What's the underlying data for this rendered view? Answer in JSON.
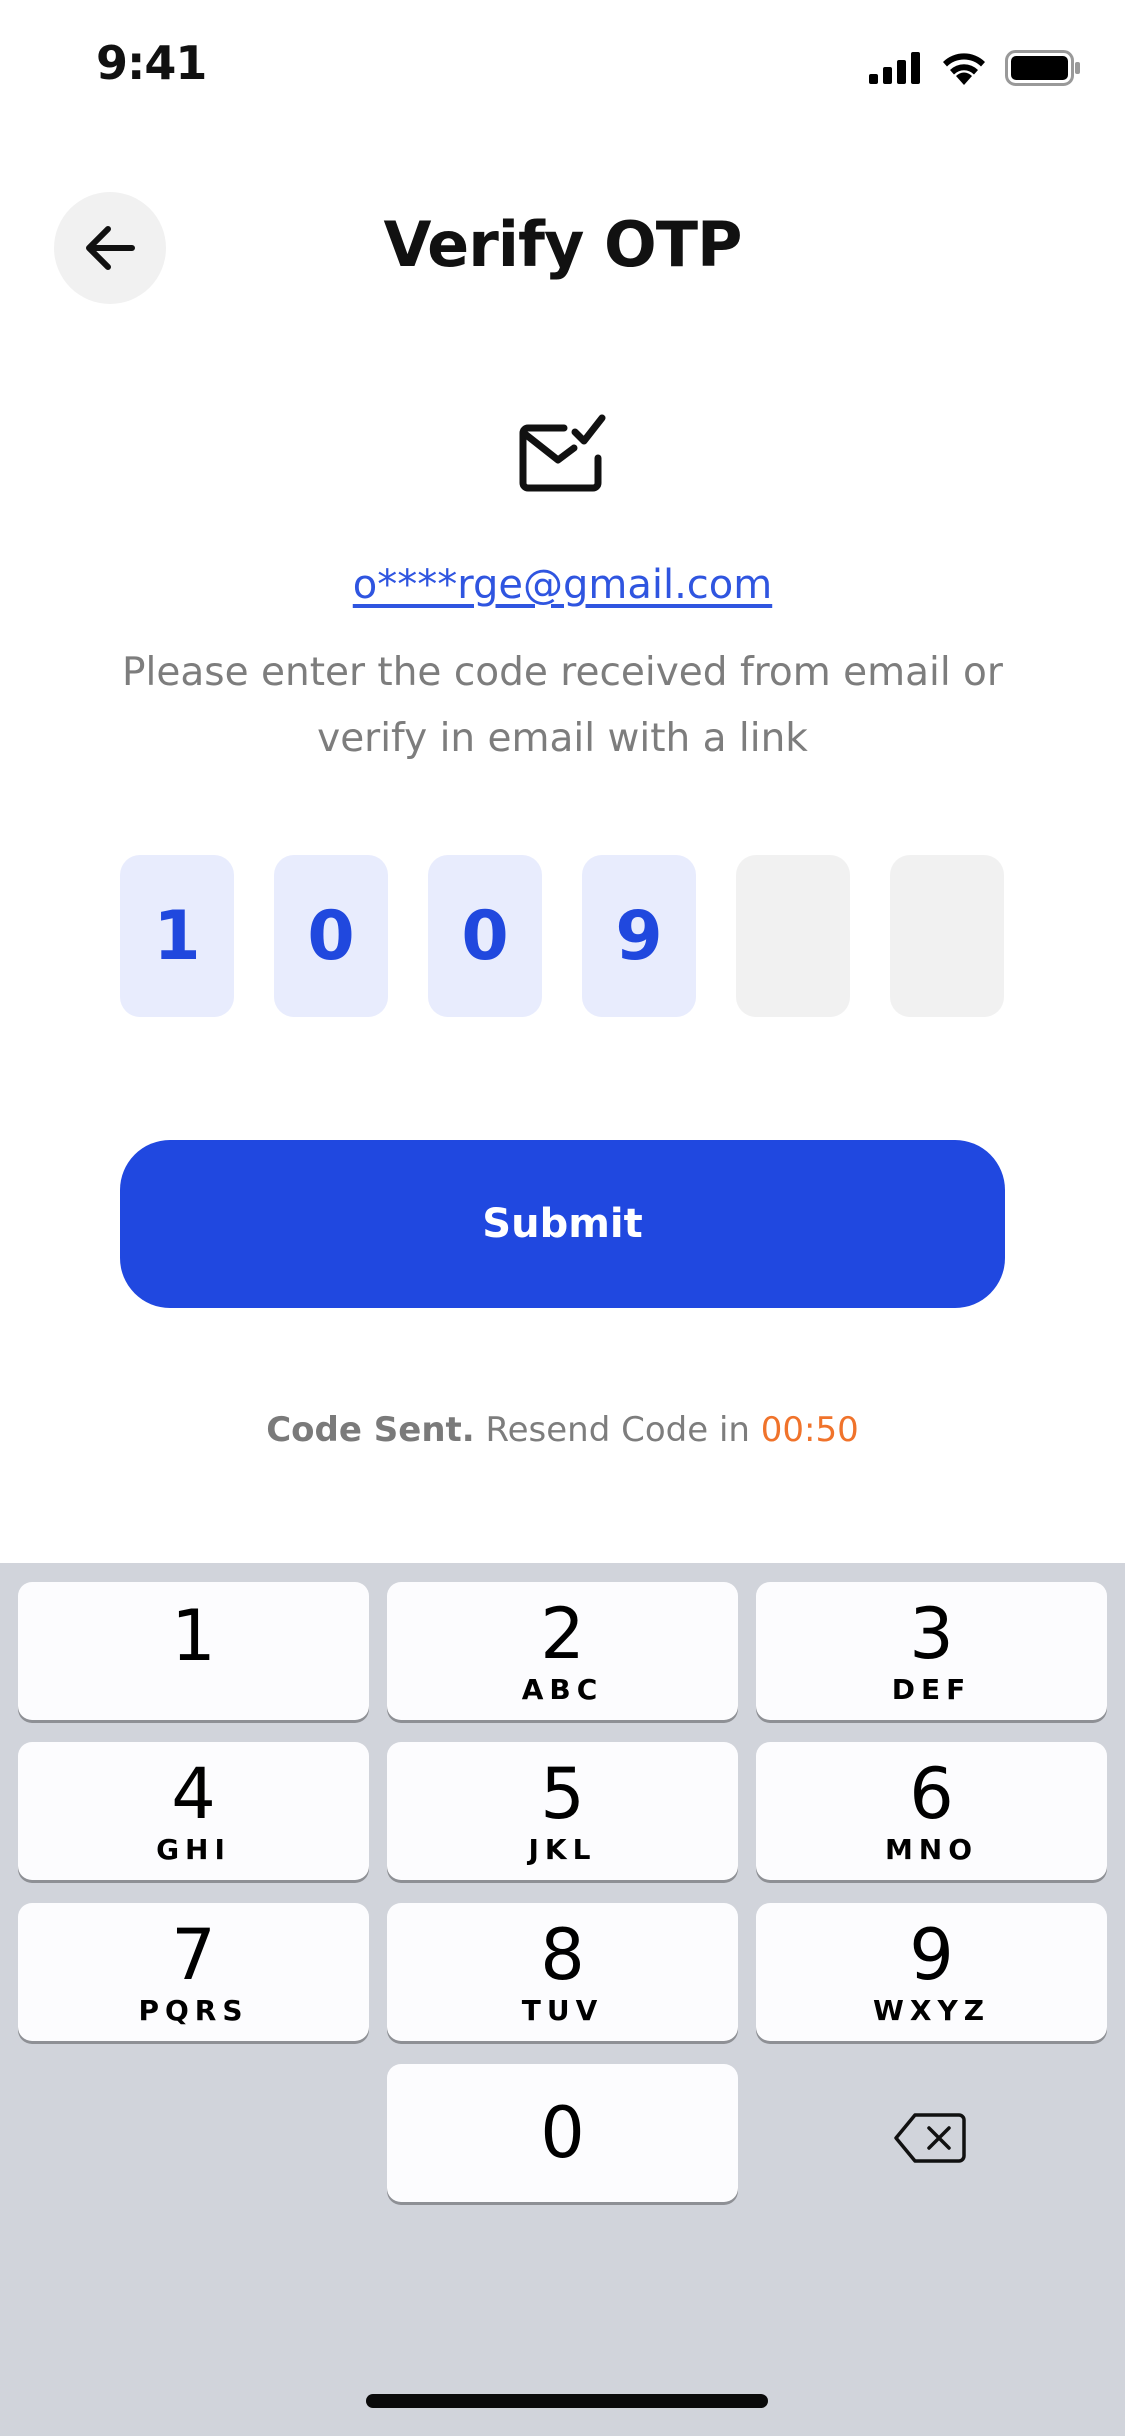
{
  "status_bar": {
    "time": "9:41"
  },
  "header": {
    "title": "Verify OTP"
  },
  "email": "o****rge@gmail.com",
  "instruction": "Please enter the code received from email or verify in email with a link",
  "otp": {
    "digits": [
      "1",
      "0",
      "0",
      "9",
      "",
      ""
    ]
  },
  "submit_label": "Submit",
  "resend": {
    "sent_label": "Code Sent.",
    "resend_label": "Resend Code in",
    "timer": "00:50"
  },
  "colors": {
    "accent": "#2048e0",
    "timer": "#f0732b",
    "link": "#2f55e0"
  },
  "keyboard": {
    "keys": [
      {
        "num": "1",
        "letters": ""
      },
      {
        "num": "2",
        "letters": "ABC"
      },
      {
        "num": "3",
        "letters": "DEF"
      },
      {
        "num": "4",
        "letters": "GHI"
      },
      {
        "num": "5",
        "letters": "JKL"
      },
      {
        "num": "6",
        "letters": "MNO"
      },
      {
        "num": "7",
        "letters": "PQRS"
      },
      {
        "num": "8",
        "letters": "TUV"
      },
      {
        "num": "9",
        "letters": "WXYZ"
      },
      {
        "num": "0",
        "letters": ""
      }
    ]
  }
}
